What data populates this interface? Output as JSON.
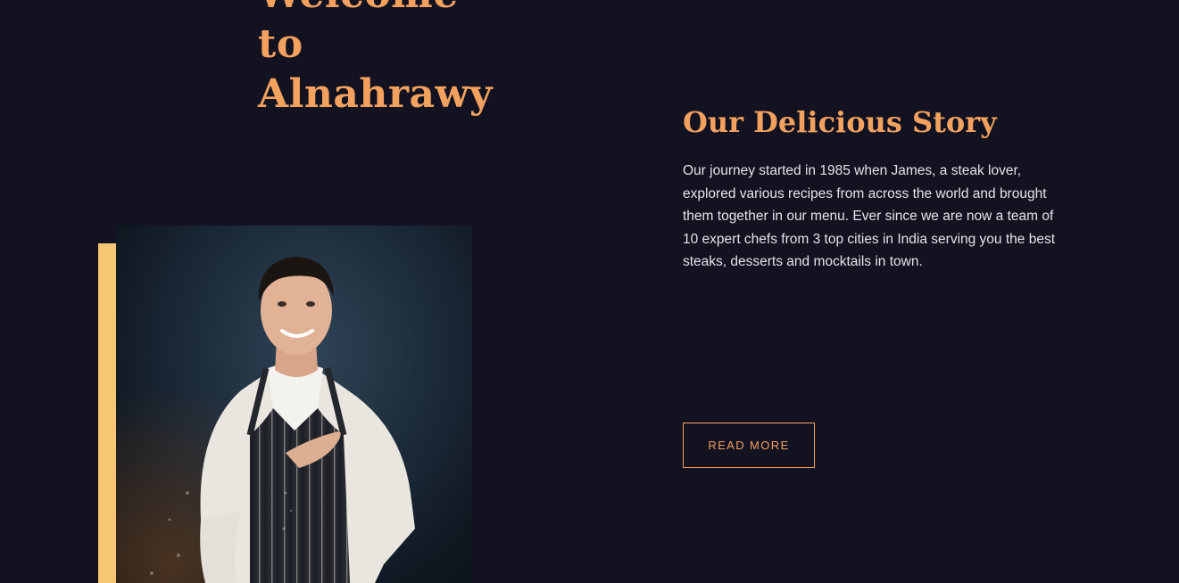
{
  "hero": {
    "title_lines": [
      "Welcome",
      "to",
      "Alnahrawy"
    ]
  },
  "about": {
    "image_subject": "chef-portrait",
    "accent_color": "#f6c675"
  },
  "story": {
    "title": "Our Delicious Story",
    "text": "Our journey started in 1985 when James, a steak lover, explored various recipes from across the world and brought them together in our menu. Ever since we are now a team of 10 expert chefs from 3 top cities in India serving you the best steaks, desserts and mocktails in town.",
    "button_label": "READ MORE"
  },
  "colors": {
    "background": "#121221",
    "heading": "#f2a15f",
    "body_text": "#e4e4ea",
    "accent_bar": "#f6c675"
  }
}
